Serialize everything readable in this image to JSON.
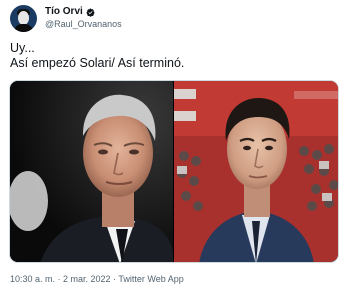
{
  "header": {
    "display_name": "Tío Orvi",
    "handle": "@Raul_Orvananos",
    "verified_icon": "verified-badge"
  },
  "tweet": {
    "line1": "Uy...",
    "line2": "Así empezó Solari/ Así terminó."
  },
  "media": {
    "left_photo": "photo-older-man-portrait",
    "right_photo": "photo-young-man-stadium"
  },
  "meta": {
    "timestamp": "10:30 a. m. · 2 mar. 2022 · Twitter Web App"
  },
  "colors": {
    "text": "#0f1419",
    "secondary": "#536471",
    "verified": "#1d9bf0"
  }
}
